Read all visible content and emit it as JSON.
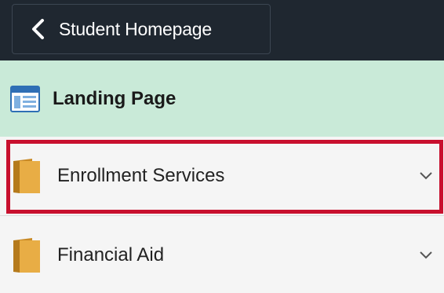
{
  "header": {
    "back_label": "Student Homepage",
    "back_icon": "chevron-left-icon"
  },
  "landing": {
    "label": "Landing Page",
    "icon": "landing-page-icon"
  },
  "nav": {
    "items": [
      {
        "label": "Enrollment Services",
        "icon": "folder-icon",
        "expand_icon": "chevron-down-icon",
        "highlighted": true
      },
      {
        "label": "Financial Aid",
        "icon": "folder-icon",
        "expand_icon": "chevron-down-icon",
        "highlighted": false
      }
    ]
  },
  "colors": {
    "header_bg": "#1f2730",
    "landing_bg": "#c9ead8",
    "highlight": "#c8102e",
    "folder": "#e3a83a"
  }
}
